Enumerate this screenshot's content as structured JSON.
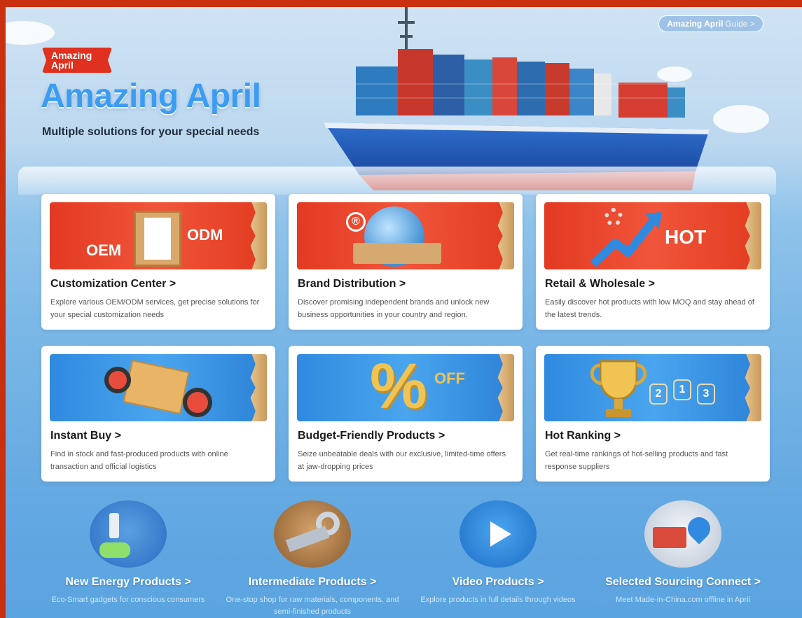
{
  "hero": {
    "guide_bold": "Amazing April",
    "guide_light": "Guide >",
    "badge_line1": "Amazing",
    "badge_line2": "April",
    "title": "Amazing April",
    "subtitle": "Multiple solutions for your special needs"
  },
  "cards": [
    {
      "title": "Customization Center >",
      "desc": "Explore various OEM/ODM services, get precise solutions for your special customization needs",
      "banner_left": "OEM",
      "banner_right": "ODM",
      "theme": "red",
      "icon": "cabinet-icon"
    },
    {
      "title": "Brand Distribution >",
      "desc": "Discover promising independent brands and unlock new business opportunities in your country and region.",
      "theme": "red",
      "icon": "globe-boxes-icon"
    },
    {
      "title": "Retail & Wholesale >",
      "desc": "Easily discover hot products with low MOQ and stay ahead of the latest trends.",
      "banner_right": "HOT",
      "theme": "red",
      "icon": "trend-arrow-icon"
    },
    {
      "title": "Instant Buy >",
      "desc": "Find in stock and fast-produced products with online transaction and official logistics",
      "theme": "blue",
      "icon": "parcel-icon"
    },
    {
      "title": "Budget-Friendly Products >",
      "desc": "Seize unbeatable deals with our exclusive, limited-time offers at jaw-dropping prices",
      "banner_right": "OFF",
      "theme": "blue",
      "icon": "percent-icon"
    },
    {
      "title": "Hot Ranking >",
      "desc": "Get real-time rankings of hot-selling products and fast response suppliers",
      "theme": "blue",
      "icon": "trophy-icon"
    }
  ],
  "categories": [
    {
      "title": "New Energy Products >",
      "desc": "Eco-Smart gadgets for conscious consumers",
      "icon": "ev-charger-icon"
    },
    {
      "title": "Intermediate Products >",
      "desc": "One-stop shop for raw materials, components, and semi-finished products",
      "icon": "pipes-icon"
    },
    {
      "title": "Video Products >",
      "desc": "Explore products in full details through videos",
      "icon": "play-icon"
    },
    {
      "title": "Selected Sourcing Connect >",
      "desc": "Meet Made-in-China.com offline in April",
      "icon": "location-pin-icon"
    }
  ]
}
